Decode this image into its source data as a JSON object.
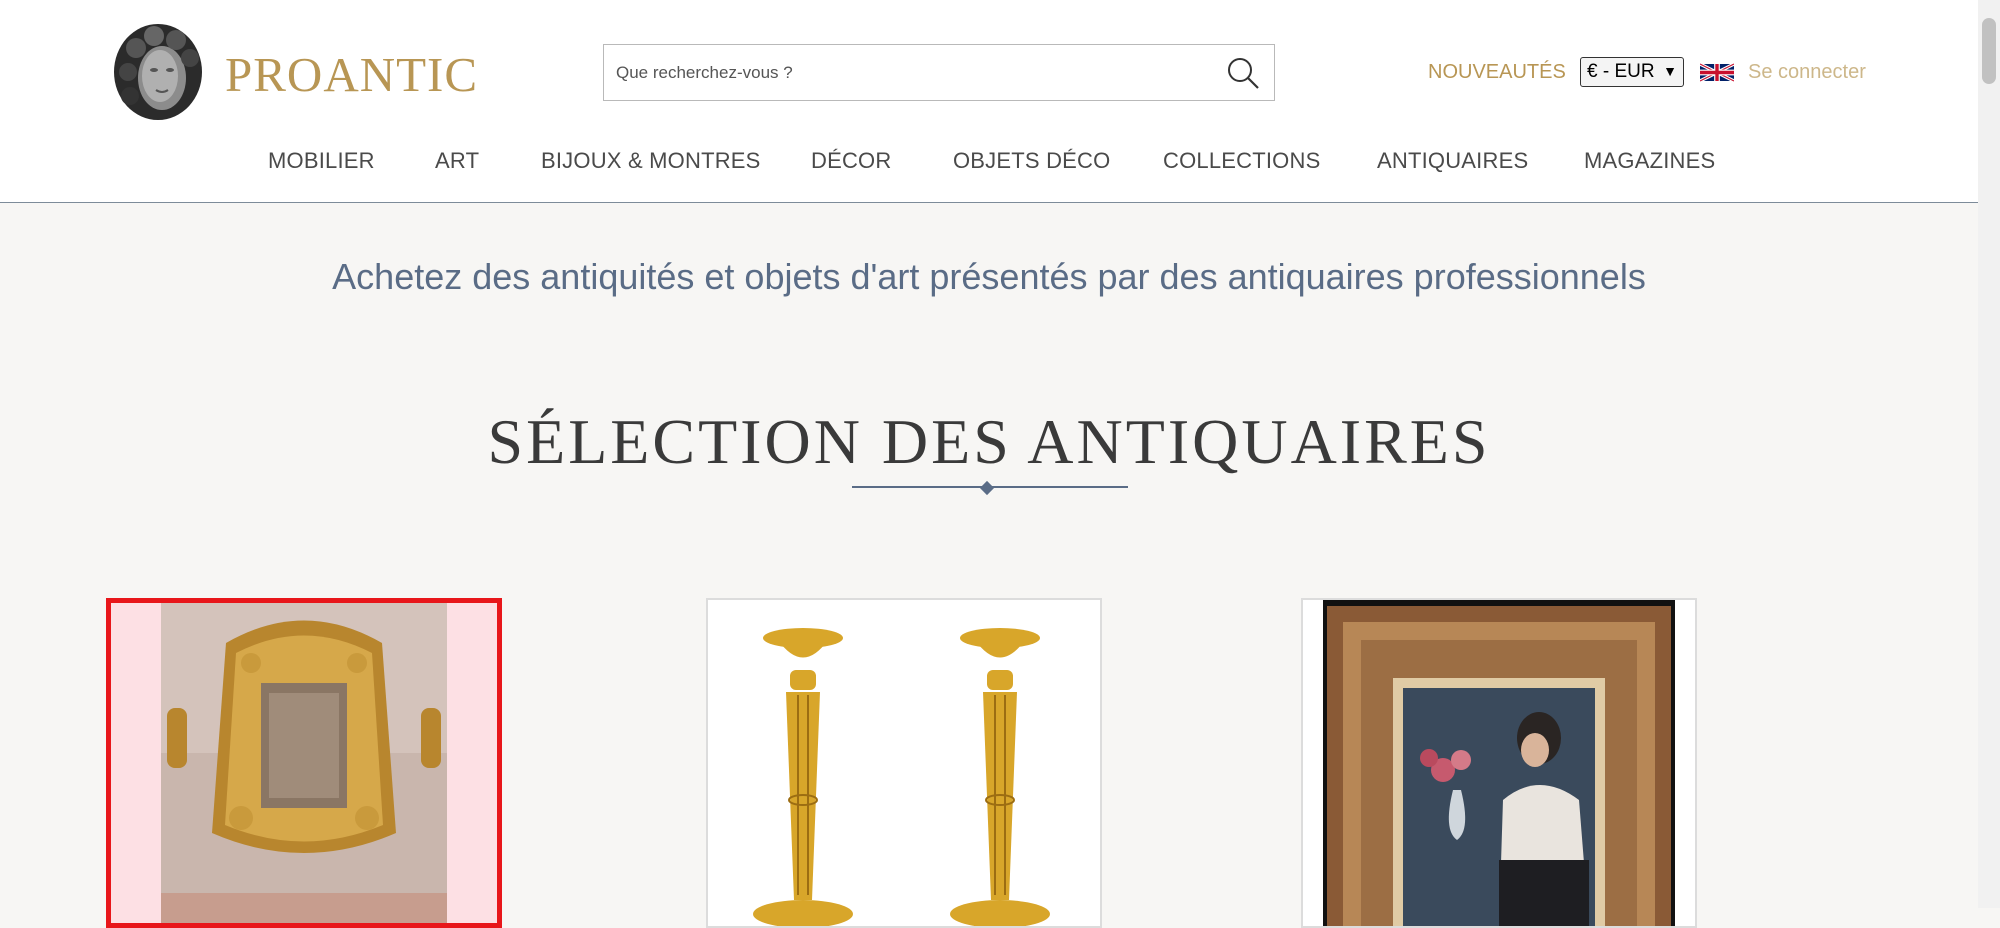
{
  "brand": {
    "name": "PROANTIC"
  },
  "search": {
    "placeholder": "Que recherchez-vous ?"
  },
  "header_links": {
    "new": "NOUVEAUTÉS",
    "login": "Se connecter"
  },
  "currency": {
    "selected": "€ - EUR"
  },
  "language_flag": "uk-flag-icon",
  "nav": [
    "MOBILIER",
    "ART",
    "BIJOUX & MONTRES",
    "DÉCOR",
    "OBJETS DÉCO",
    "COLLECTIONS",
    "ANTIQUAIRES",
    "MAGAZINES"
  ],
  "tagline": "Achetez des antiquités et objets d'art présentés par des antiquaires professionnels",
  "section": {
    "title": "SÉLECTION DES ANTIQUAIRES"
  },
  "products": [
    {
      "name": "gilded-mirror-image",
      "selected": true
    },
    {
      "name": "candlesticks-image",
      "selected": false
    },
    {
      "name": "framed-painting-image",
      "selected": false
    }
  ],
  "colors": {
    "brand_gold": "#b89654",
    "nav_text": "#4a4a4a",
    "tagline_blue": "#5a6c86",
    "selection_red": "#e8161a"
  }
}
